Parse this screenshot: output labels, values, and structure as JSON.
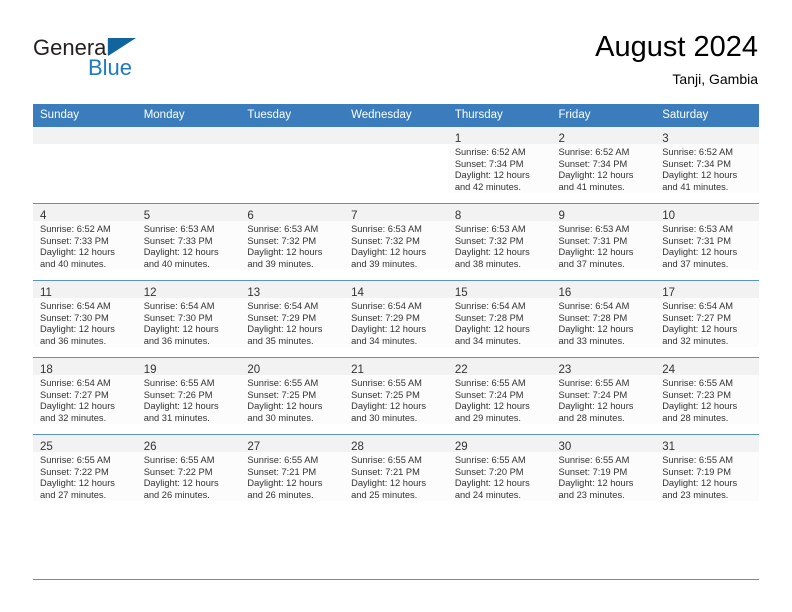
{
  "brand": {
    "name_primary": "General",
    "name_secondary": "Blue",
    "triangle_color": "#11659e",
    "blue_color": "#1f7bc1"
  },
  "header": {
    "title": "August 2024",
    "subtitle": "Tanji, Gambia"
  },
  "theme": {
    "header_row_bg": "#3b7cbc",
    "header_row_text": "#ffffff",
    "daynum_bar_bg": "#f2f2f2",
    "grid_line": "#5b93c8",
    "body_text": "#333333"
  },
  "weekday_headers": [
    "Sunday",
    "Monday",
    "Tuesday",
    "Wednesday",
    "Thursday",
    "Friday",
    "Saturday"
  ],
  "labels": {
    "sunrise_prefix": "Sunrise:",
    "sunset_prefix": "Sunset:",
    "daylight_prefix": "Daylight:"
  },
  "weeks": [
    [
      {
        "day": "",
        "lines": [
          "",
          "",
          "",
          ""
        ]
      },
      {
        "day": "",
        "lines": [
          "",
          "",
          "",
          ""
        ]
      },
      {
        "day": "",
        "lines": [
          "",
          "",
          "",
          ""
        ]
      },
      {
        "day": "",
        "lines": [
          "",
          "",
          "",
          ""
        ]
      },
      {
        "day": "1",
        "lines": [
          "Sunrise: 6:52 AM",
          "Sunset: 7:34 PM",
          "Daylight: 12 hours",
          "and 42 minutes."
        ]
      },
      {
        "day": "2",
        "lines": [
          "Sunrise: 6:52 AM",
          "Sunset: 7:34 PM",
          "Daylight: 12 hours",
          "and 41 minutes."
        ]
      },
      {
        "day": "3",
        "lines": [
          "Sunrise: 6:52 AM",
          "Sunset: 7:34 PM",
          "Daylight: 12 hours",
          "and 41 minutes."
        ]
      }
    ],
    [
      {
        "day": "4",
        "lines": [
          "Sunrise: 6:52 AM",
          "Sunset: 7:33 PM",
          "Daylight: 12 hours",
          "and 40 minutes."
        ]
      },
      {
        "day": "5",
        "lines": [
          "Sunrise: 6:53 AM",
          "Sunset: 7:33 PM",
          "Daylight: 12 hours",
          "and 40 minutes."
        ]
      },
      {
        "day": "6",
        "lines": [
          "Sunrise: 6:53 AM",
          "Sunset: 7:32 PM",
          "Daylight: 12 hours",
          "and 39 minutes."
        ]
      },
      {
        "day": "7",
        "lines": [
          "Sunrise: 6:53 AM",
          "Sunset: 7:32 PM",
          "Daylight: 12 hours",
          "and 39 minutes."
        ]
      },
      {
        "day": "8",
        "lines": [
          "Sunrise: 6:53 AM",
          "Sunset: 7:32 PM",
          "Daylight: 12 hours",
          "and 38 minutes."
        ]
      },
      {
        "day": "9",
        "lines": [
          "Sunrise: 6:53 AM",
          "Sunset: 7:31 PM",
          "Daylight: 12 hours",
          "and 37 minutes."
        ]
      },
      {
        "day": "10",
        "lines": [
          "Sunrise: 6:53 AM",
          "Sunset: 7:31 PM",
          "Daylight: 12 hours",
          "and 37 minutes."
        ]
      }
    ],
    [
      {
        "day": "11",
        "lines": [
          "Sunrise: 6:54 AM",
          "Sunset: 7:30 PM",
          "Daylight: 12 hours",
          "and 36 minutes."
        ]
      },
      {
        "day": "12",
        "lines": [
          "Sunrise: 6:54 AM",
          "Sunset: 7:30 PM",
          "Daylight: 12 hours",
          "and 36 minutes."
        ]
      },
      {
        "day": "13",
        "lines": [
          "Sunrise: 6:54 AM",
          "Sunset: 7:29 PM",
          "Daylight: 12 hours",
          "and 35 minutes."
        ]
      },
      {
        "day": "14",
        "lines": [
          "Sunrise: 6:54 AM",
          "Sunset: 7:29 PM",
          "Daylight: 12 hours",
          "and 34 minutes."
        ]
      },
      {
        "day": "15",
        "lines": [
          "Sunrise: 6:54 AM",
          "Sunset: 7:28 PM",
          "Daylight: 12 hours",
          "and 34 minutes."
        ]
      },
      {
        "day": "16",
        "lines": [
          "Sunrise: 6:54 AM",
          "Sunset: 7:28 PM",
          "Daylight: 12 hours",
          "and 33 minutes."
        ]
      },
      {
        "day": "17",
        "lines": [
          "Sunrise: 6:54 AM",
          "Sunset: 7:27 PM",
          "Daylight: 12 hours",
          "and 32 minutes."
        ]
      }
    ],
    [
      {
        "day": "18",
        "lines": [
          "Sunrise: 6:54 AM",
          "Sunset: 7:27 PM",
          "Daylight: 12 hours",
          "and 32 minutes."
        ]
      },
      {
        "day": "19",
        "lines": [
          "Sunrise: 6:55 AM",
          "Sunset: 7:26 PM",
          "Daylight: 12 hours",
          "and 31 minutes."
        ]
      },
      {
        "day": "20",
        "lines": [
          "Sunrise: 6:55 AM",
          "Sunset: 7:25 PM",
          "Daylight: 12 hours",
          "and 30 minutes."
        ]
      },
      {
        "day": "21",
        "lines": [
          "Sunrise: 6:55 AM",
          "Sunset: 7:25 PM",
          "Daylight: 12 hours",
          "and 30 minutes."
        ]
      },
      {
        "day": "22",
        "lines": [
          "Sunrise: 6:55 AM",
          "Sunset: 7:24 PM",
          "Daylight: 12 hours",
          "and 29 minutes."
        ]
      },
      {
        "day": "23",
        "lines": [
          "Sunrise: 6:55 AM",
          "Sunset: 7:24 PM",
          "Daylight: 12 hours",
          "and 28 minutes."
        ]
      },
      {
        "day": "24",
        "lines": [
          "Sunrise: 6:55 AM",
          "Sunset: 7:23 PM",
          "Daylight: 12 hours",
          "and 28 minutes."
        ]
      }
    ],
    [
      {
        "day": "25",
        "lines": [
          "Sunrise: 6:55 AM",
          "Sunset: 7:22 PM",
          "Daylight: 12 hours",
          "and 27 minutes."
        ]
      },
      {
        "day": "26",
        "lines": [
          "Sunrise: 6:55 AM",
          "Sunset: 7:22 PM",
          "Daylight: 12 hours",
          "and 26 minutes."
        ]
      },
      {
        "day": "27",
        "lines": [
          "Sunrise: 6:55 AM",
          "Sunset: 7:21 PM",
          "Daylight: 12 hours",
          "and 26 minutes."
        ]
      },
      {
        "day": "28",
        "lines": [
          "Sunrise: 6:55 AM",
          "Sunset: 7:21 PM",
          "Daylight: 12 hours",
          "and 25 minutes."
        ]
      },
      {
        "day": "29",
        "lines": [
          "Sunrise: 6:55 AM",
          "Sunset: 7:20 PM",
          "Daylight: 12 hours",
          "and 24 minutes."
        ]
      },
      {
        "day": "30",
        "lines": [
          "Sunrise: 6:55 AM",
          "Sunset: 7:19 PM",
          "Daylight: 12 hours",
          "and 23 minutes."
        ]
      },
      {
        "day": "31",
        "lines": [
          "Sunrise: 6:55 AM",
          "Sunset: 7:19 PM",
          "Daylight: 12 hours",
          "and 23 minutes."
        ]
      }
    ]
  ]
}
